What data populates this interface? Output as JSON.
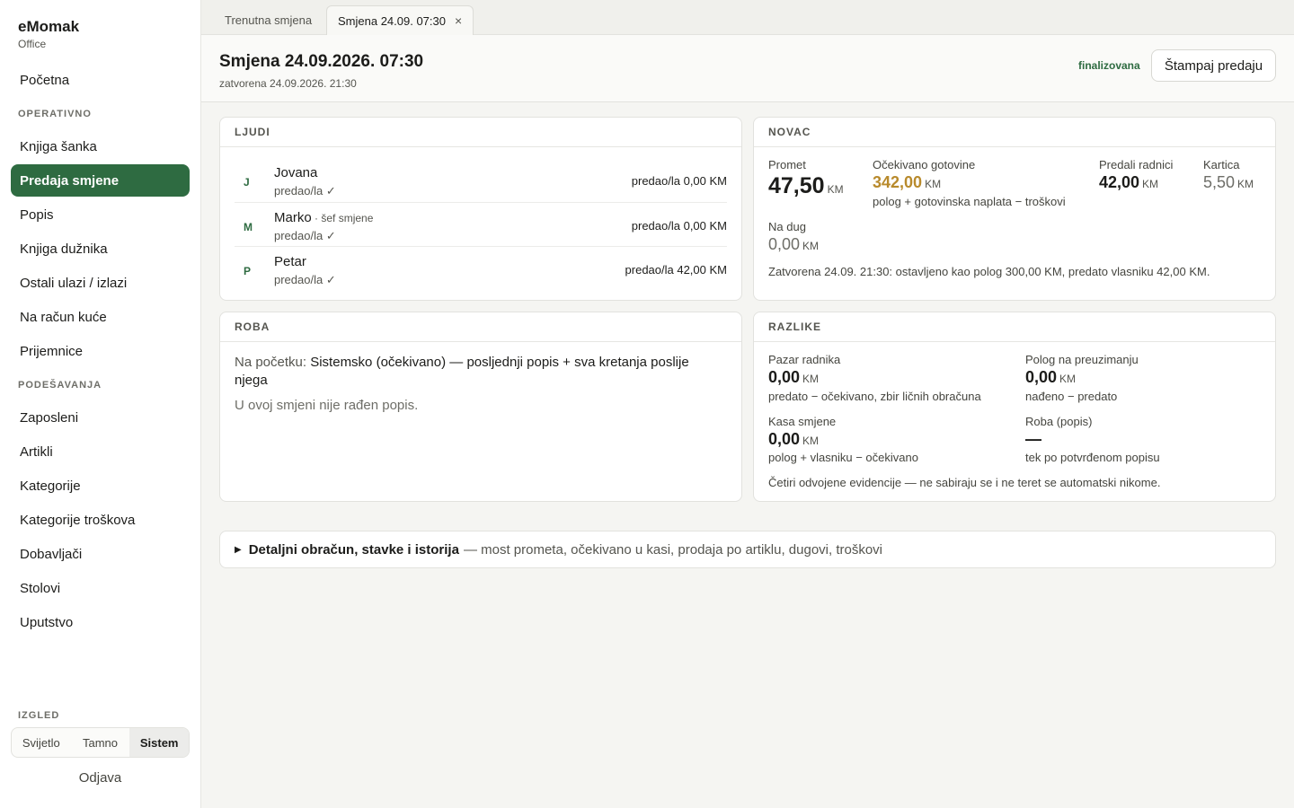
{
  "brand": {
    "name": "eMomak",
    "subtitle": "Office"
  },
  "nav": {
    "home": "Početna",
    "section_operativno": "OPERATIVNO",
    "knjiga_sanka": "Knjiga šanka",
    "predaja_smjene": "Predaja smjene",
    "popis": "Popis",
    "knjiga_duznika": "Knjiga dužnika",
    "ostali_ulazi": "Ostali ulazi / izlazi",
    "na_racun_kuce": "Na račun kuće",
    "prijemnice": "Prijemnice",
    "section_podesavanja": "PODEŠAVANJA",
    "zaposleni": "Zaposleni",
    "artikli": "Artikli",
    "kategorije": "Kategorije",
    "kategorije_troskova": "Kategorije troškova",
    "dobavljaci": "Dobavljači",
    "stolovi": "Stolovi",
    "uputstvo": "Uputstvo"
  },
  "appearance": {
    "label": "IZGLED",
    "options": [
      "Svijetlo",
      "Tamno",
      "Sistem"
    ],
    "selected": "Sistem"
  },
  "logout": "Odjava",
  "tabs": {
    "current": "Trenutna smjena",
    "open": "Smjena 24.09. 07:30",
    "close_icon": "×"
  },
  "header": {
    "title": "Smjena 24.09.2026. 07:30",
    "subtitle": "zatvorena 24.09.2026. 21:30",
    "status": "finalizovana",
    "print": "Štampaj predaju"
  },
  "people": {
    "heading": "LJUDI",
    "rows": [
      {
        "initial": "J",
        "name": "Jovana",
        "role": "",
        "status": "predao/la ✓",
        "amount": "predao/la 0,00 KM"
      },
      {
        "initial": "M",
        "name": "Marko",
        "role": " · šef smjene",
        "status": "predao/la ✓",
        "amount": "predao/la 0,00 KM"
      },
      {
        "initial": "P",
        "name": "Petar",
        "role": "",
        "status": "predao/la ✓",
        "amount": "predao/la 42,00 KM"
      }
    ]
  },
  "money": {
    "heading": "NOVAC",
    "unit": "KM",
    "promet_label": "Promet",
    "promet_value": "47,50",
    "expected_label": "Očekivano gotovine",
    "expected_value": "342,00",
    "expected_note": "polog + gotovinska naplata − troškovi",
    "handed_label": "Predali radnici",
    "handed_value": "42,00",
    "card_label": "Kartica",
    "card_value": "5,50",
    "debt_label": "Na dug",
    "debt_value": "0,00",
    "summary": "Zatvorena 24.09. 21:30: ostavljeno kao polog 300,00 KM, predato vlasniku 42,00 KM.",
    "expected_color": "#b88a2c"
  },
  "goods": {
    "heading": "ROBA",
    "start_label": "Na početku: ",
    "start_value": "Sistemsko (očekivano) — posljednji popis + sva kretanja poslije njega",
    "empty": "U ovoj smjeni nije rađen popis."
  },
  "diff": {
    "heading": "RAZLIKE",
    "unit": "KM",
    "pazar_label": "Pazar radnika",
    "pazar_value": "0,00",
    "pazar_note": "predato − očekivano, zbir ličnih obračuna",
    "polog_label": "Polog na preuzimanju",
    "polog_value": "0,00",
    "polog_note": "nađeno − predato",
    "kasa_label": "Kasa smjene",
    "kasa_value": "0,00",
    "kasa_note": "polog + vlasniku − očekivano",
    "roba_label": "Roba (popis)",
    "roba_value": "—",
    "roba_note": "tek po potvrđenom popisu",
    "footer": "Četiri odvojene evidencije — ne sabiraju se i ne teret se automatski nikome."
  },
  "details": {
    "title": "Detaljni obračun, stavke i istorija",
    "subtitle": "— most prometa, očekivano u kasi, prodaja po artiklu, dugovi, troškovi"
  },
  "colors": {
    "accent": "#2e6b41",
    "gold": "#b88a2c"
  }
}
